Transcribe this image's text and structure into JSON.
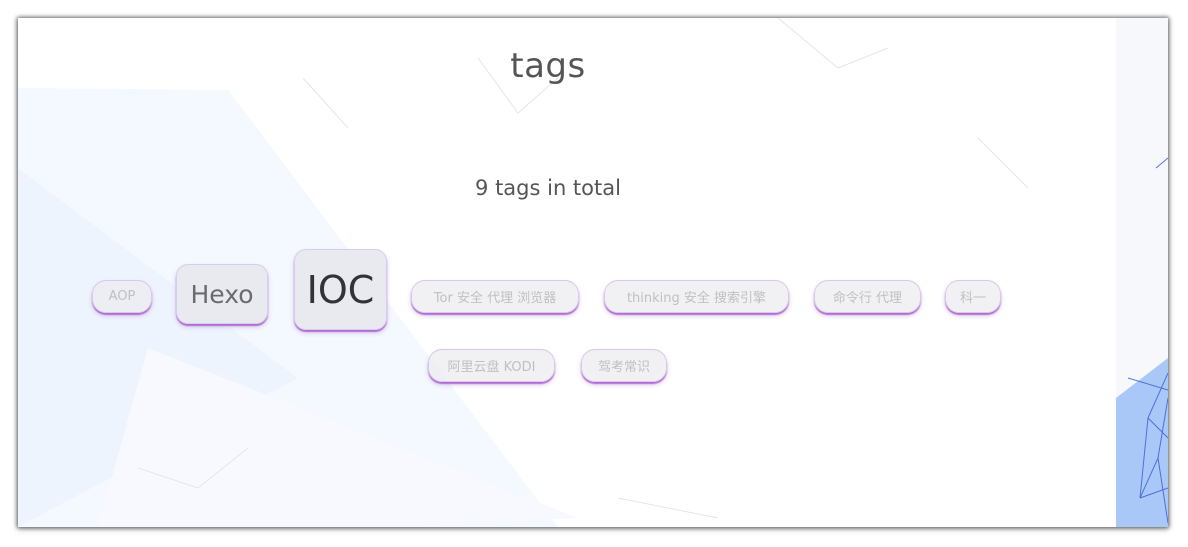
{
  "page": {
    "title": "tags",
    "count_text": "9 tags in total"
  },
  "tags": [
    {
      "label": "AOP",
      "size": "small"
    },
    {
      "label": "Hexo",
      "size": "mid"
    },
    {
      "label": "IOC",
      "size": "big"
    },
    {
      "label": "Tor 安全 代理 浏览器",
      "size": "small"
    },
    {
      "label": "thinking 安全 搜索引擎",
      "size": "small"
    },
    {
      "label": "命令行 代理",
      "size": "small"
    },
    {
      "label": "科一",
      "size": "small"
    },
    {
      "label": "阿里云盘 KODI",
      "size": "small"
    },
    {
      "label": "驾考常识",
      "size": "small"
    }
  ],
  "colors": {
    "tag_shadow": "#aa5ad2",
    "text": "#555555",
    "background_accent": "#9dc0f5"
  }
}
